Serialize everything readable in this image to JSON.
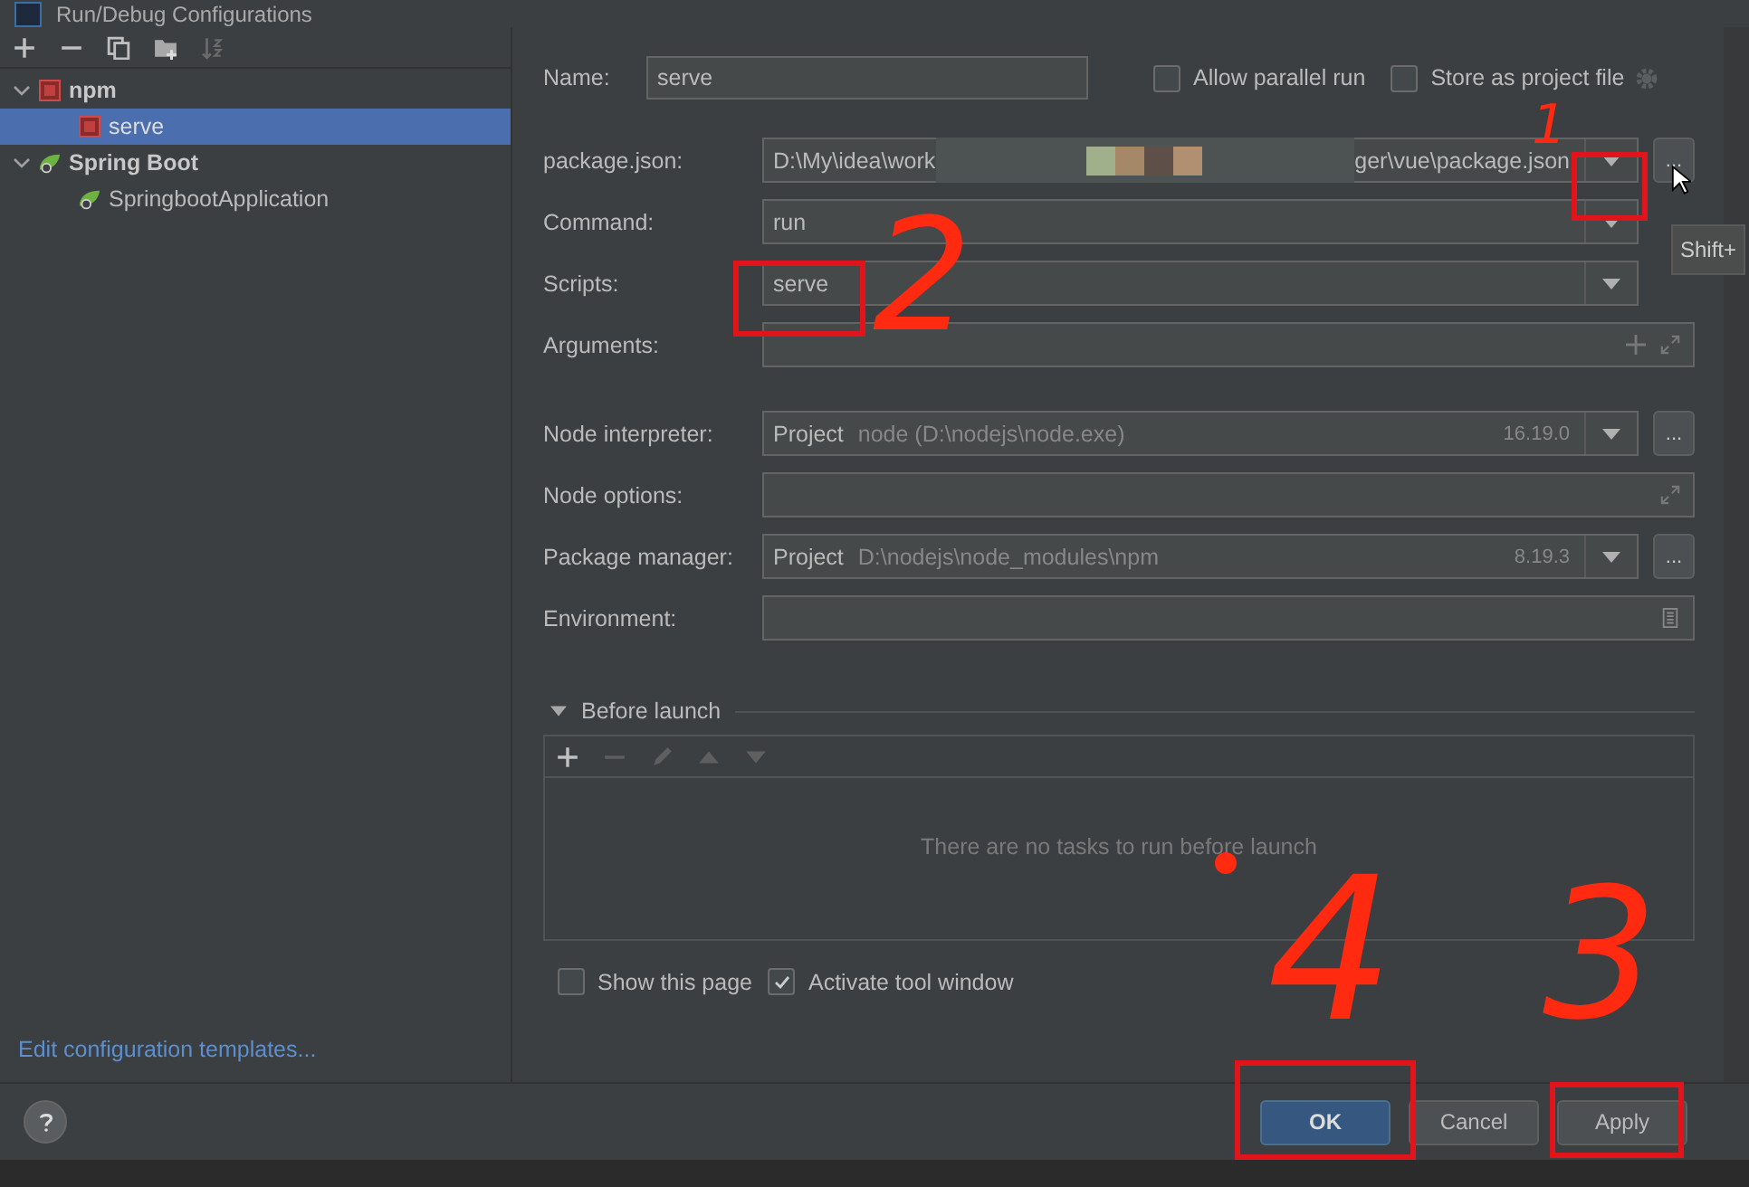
{
  "window": {
    "title": "Run/Debug Configurations"
  },
  "tree": [
    {
      "label": "npm",
      "kind": "npm",
      "expanded": true,
      "children": [
        {
          "label": "serve",
          "kind": "npm",
          "selected": true
        }
      ]
    },
    {
      "label": "Spring Boot",
      "kind": "spring",
      "expanded": true,
      "children": [
        {
          "label": "SpringbootApplication",
          "kind": "spring",
          "selected": false
        }
      ]
    }
  ],
  "templates_link": "Edit configuration templates...",
  "name": {
    "label": "Name:",
    "value": "serve"
  },
  "options": [
    {
      "label": "Allow parallel run",
      "checked": false
    },
    {
      "label": "Store as project file",
      "checked": false
    }
  ],
  "field_groups": [
    [
      {
        "kind": "path",
        "label": "package.json:",
        "value_start": "D:\\My\\idea\\work",
        "value_end": "ger\\vue\\package.json",
        "browse": "..."
      },
      {
        "kind": "combo",
        "label": "Command:",
        "value": "run"
      },
      {
        "kind": "combo",
        "label": "Scripts:",
        "value": "serve"
      },
      {
        "kind": "args",
        "label": "Arguments:"
      }
    ],
    [
      {
        "kind": "interpreter",
        "label": "Node interpreter:",
        "prefix": "Project",
        "value": "node (D:\\nodejs\\node.exe)",
        "version": "16.19.0",
        "browse": "..."
      },
      {
        "kind": "options",
        "label": "Node options:"
      },
      {
        "kind": "interpreter",
        "label": "Package manager:",
        "prefix": "Project",
        "value": "D:\\nodejs\\node_modules\\npm",
        "version": "8.19.3",
        "browse": "..."
      },
      {
        "kind": "env",
        "label": "Environment:"
      }
    ]
  ],
  "tooltip": "Shift+",
  "before_launch": {
    "label": "Before launch",
    "expanded": true,
    "empty_text": "There are no tasks to run before launch"
  },
  "launch_options": [
    {
      "label": "Show this page",
      "checked": false
    },
    {
      "label": "Activate tool window",
      "checked": true
    }
  ],
  "buttons": [
    {
      "label": "OK",
      "kind": "primary"
    },
    {
      "label": "Cancel",
      "kind": "normal"
    },
    {
      "label": "Apply",
      "kind": "normal"
    }
  ],
  "annotations": [
    {
      "kind": "box"
    },
    {
      "kind": "number",
      "label": "1"
    },
    {
      "kind": "box"
    },
    {
      "kind": "number",
      "label": "2"
    },
    {
      "kind": "box"
    },
    {
      "kind": "number",
      "label": "4"
    },
    {
      "kind": "box"
    },
    {
      "kind": "number",
      "label": "3"
    },
    {
      "kind": "dot"
    }
  ]
}
